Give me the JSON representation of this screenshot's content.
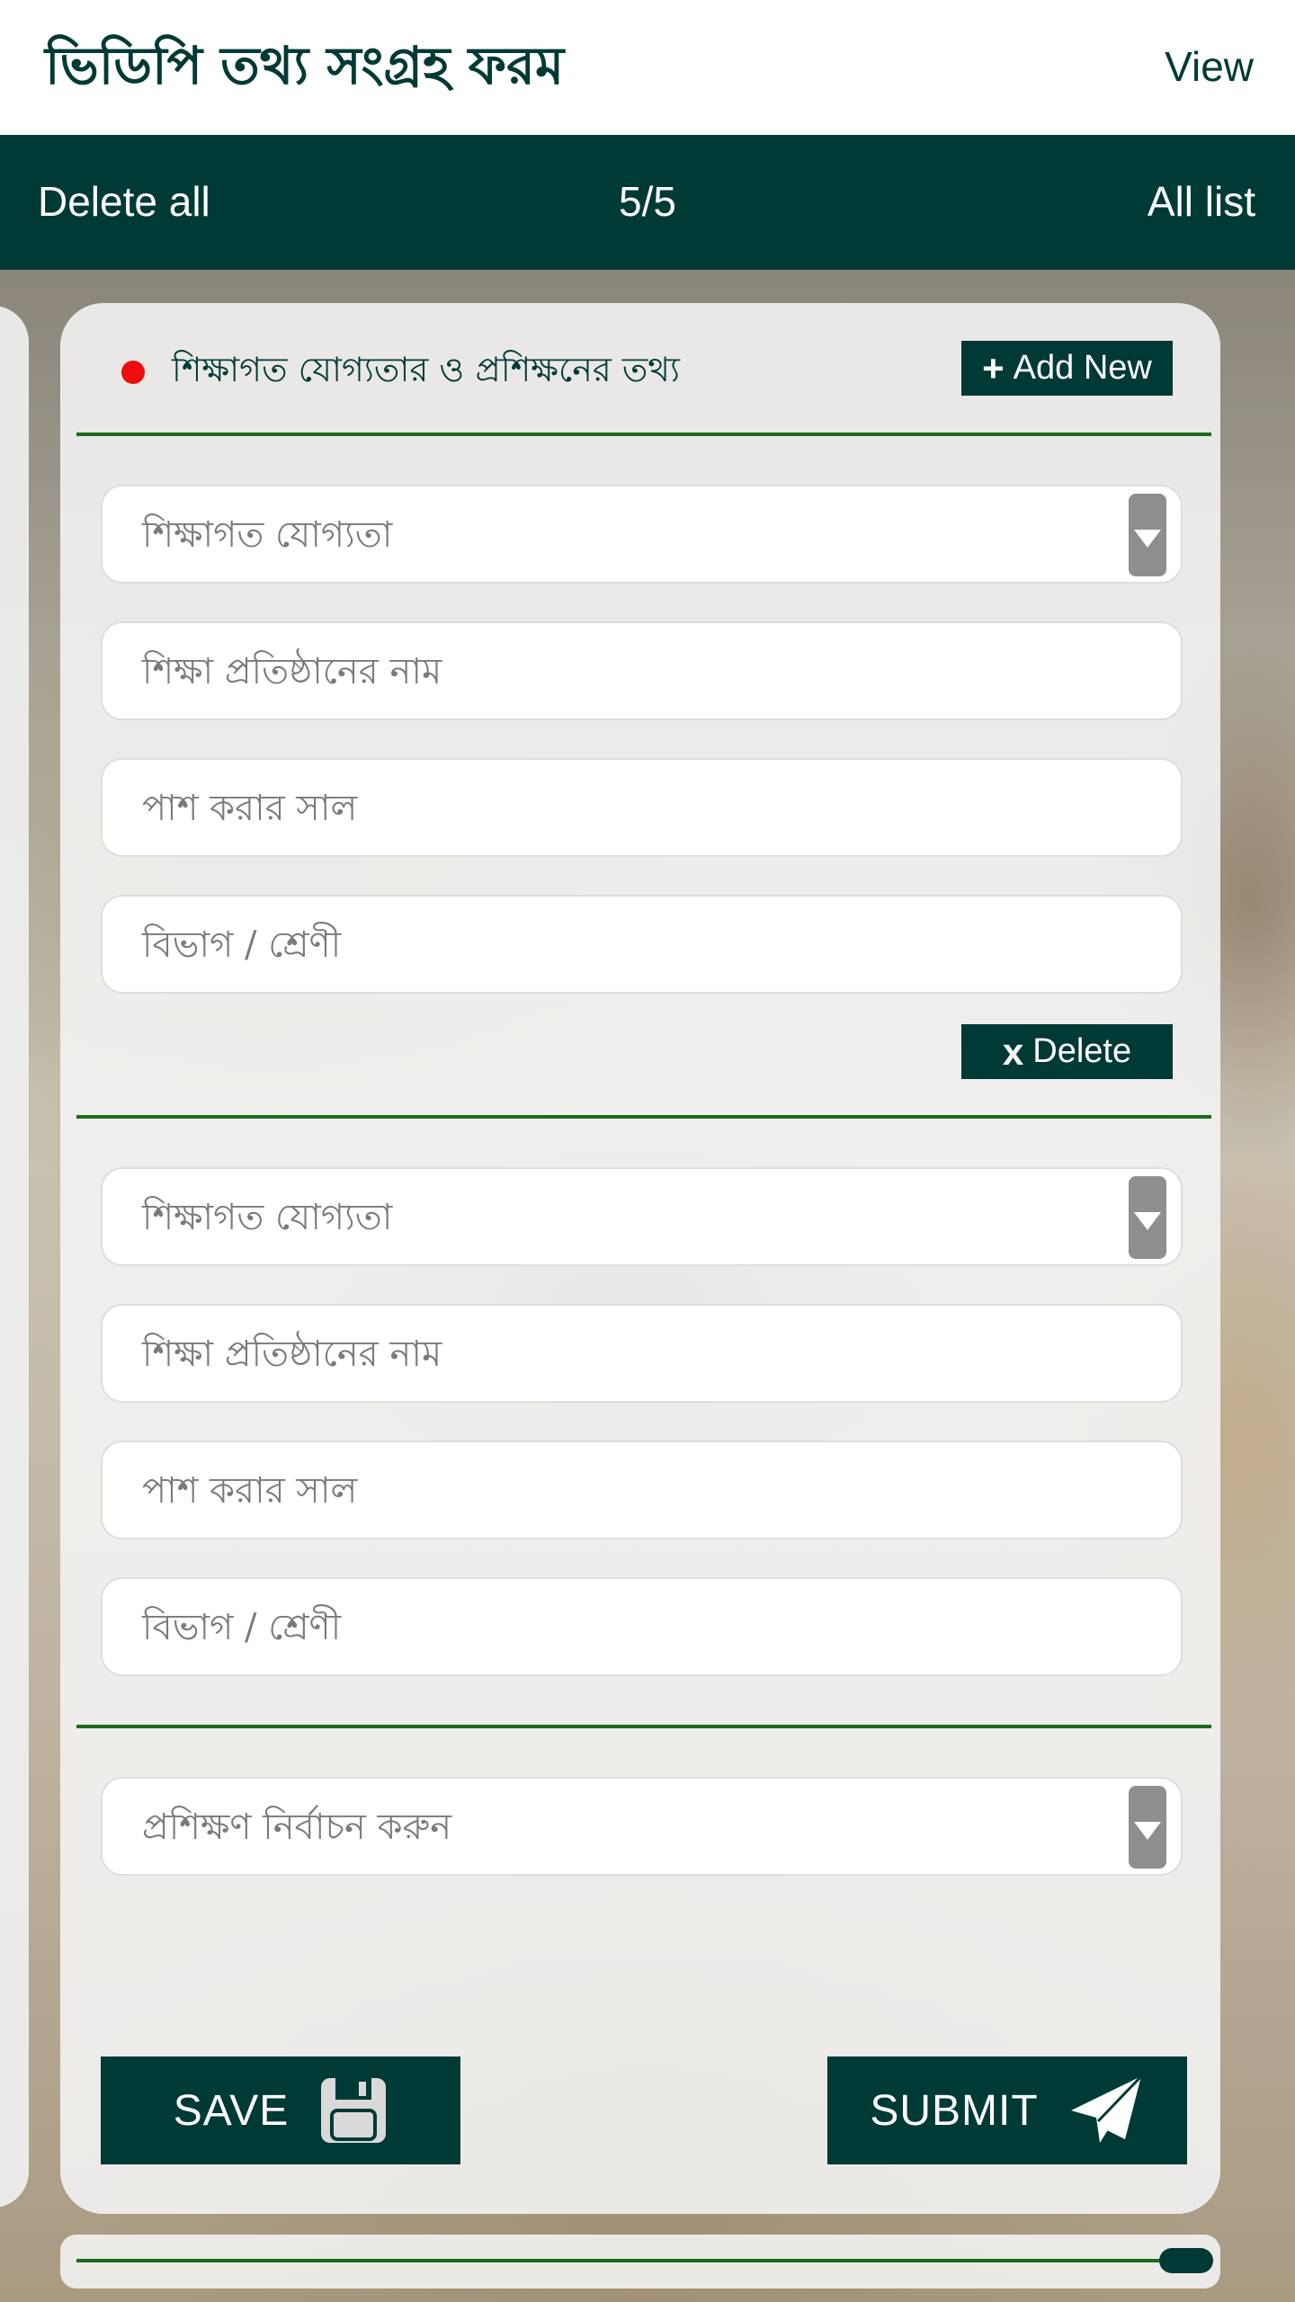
{
  "header": {
    "title": "ভিডিপি তথ্য সংগ্রহ ফরম",
    "view_label": "View"
  },
  "toolbar": {
    "delete_all_label": "Delete all",
    "page_counter": "5/5",
    "all_list_label": "All list"
  },
  "section": {
    "title": "শিক্ষাগত যোগ্যতার ও প্রশিক্ষনের তথ্য",
    "add_new_label": "Add New",
    "delete_label": "Delete"
  },
  "education_entries": [
    {
      "qualification_placeholder": "শিক্ষাগত যোগ্যতা",
      "institution_placeholder": "শিক্ষা প্রতিষ্ঠানের নাম",
      "passing_year_placeholder": "পাশ করার সাল",
      "division_placeholder": "বিভাগ / শ্রেণী"
    },
    {
      "qualification_placeholder": "শিক্ষাগত যোগ্যতা",
      "institution_placeholder": "শিক্ষা প্রতিষ্ঠানের নাম",
      "passing_year_placeholder": "পাশ করার সাল",
      "division_placeholder": "বিভাগ / শ্রেণী"
    }
  ],
  "training": {
    "select_placeholder": "প্রশিক্ষণ নির্বাচন করুন"
  },
  "actions": {
    "save_label": "SAVE",
    "submit_label": "SUBMIT"
  },
  "icons": {
    "add": "plus-icon",
    "delete": "x-icon",
    "dropdown": "chevron-down-icon",
    "save": "floppy-disk-icon",
    "submit": "paper-plane-icon"
  },
  "colors": {
    "primary": "#003a35",
    "divider": "#1e6b1e",
    "required_dot": "#ee0d0d"
  }
}
